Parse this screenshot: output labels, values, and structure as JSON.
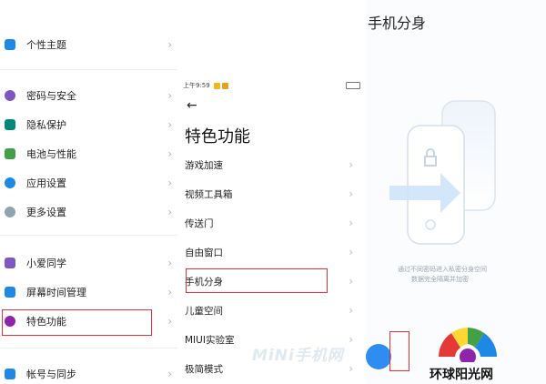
{
  "settings_list": {
    "items": [
      {
        "label": "个性主题",
        "icon": "theme-icon",
        "color": "#1e88e5"
      },
      {
        "label": "密码与安全",
        "icon": "password-icon",
        "color": "#7e57c2"
      },
      {
        "label": "隐私保护",
        "icon": "privacy-icon",
        "color": "#00897b"
      },
      {
        "label": "电池与性能",
        "icon": "battery-icon",
        "color": "#43a047"
      },
      {
        "label": "应用设置",
        "icon": "app-settings-icon",
        "color": "#1e88e5"
      },
      {
        "label": "更多设置",
        "icon": "more-settings-icon",
        "color": "#90a4ae"
      },
      {
        "label": "小爱同学",
        "icon": "xiaoai-icon",
        "color": "#7e57c2"
      },
      {
        "label": "屏幕时间管理",
        "icon": "screen-time-icon",
        "color": "#1e88e5"
      },
      {
        "label": "特色功能",
        "icon": "special-features-icon",
        "color": "#8e24aa"
      },
      {
        "label": "帐号与同步",
        "icon": "account-icon",
        "color": "#1e88e5"
      }
    ]
  },
  "features_page": {
    "status_time": "上午9:59",
    "back_symbol": "←",
    "title": "特色功能",
    "items": [
      {
        "label": "游戏加速"
      },
      {
        "label": "视频工具箱"
      },
      {
        "label": "传送门"
      },
      {
        "label": "自由窗口"
      },
      {
        "label": "手机分身"
      },
      {
        "label": "儿童空间"
      },
      {
        "label": "MIUI实验室"
      },
      {
        "label": "极简模式"
      }
    ]
  },
  "second_space": {
    "title": "手机分身",
    "description_line1": "通过不同密码进入私密分身空间",
    "description_line2": "数据完全隔离并加密"
  },
  "watermark": {
    "text_mid": "MiNi手机网",
    "text_right": "环球阳光网"
  },
  "colors": {
    "highlight": "#e0303a",
    "accent": "#2f8cf0"
  }
}
